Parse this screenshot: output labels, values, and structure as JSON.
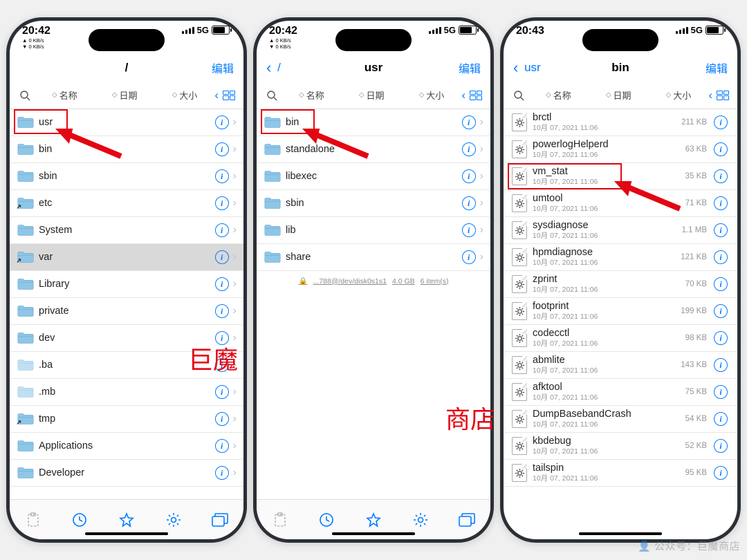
{
  "status": {
    "time1": "20:42",
    "time2": "20:42",
    "time3": "20:43",
    "kb_up": "▲ 0 KB/s",
    "kb_dn": "▼ 0 KB/s",
    "net": "5G"
  },
  "labels": {
    "edit": "编辑",
    "back_root": "/",
    "back_usr": "usr",
    "sort_name": "名称",
    "sort_date": "日期",
    "sort_size": "大小"
  },
  "phone1": {
    "title": "/",
    "items": [
      {
        "name": "usr"
      },
      {
        "name": "bin"
      },
      {
        "name": "sbin"
      },
      {
        "name": "etc"
      },
      {
        "name": "System"
      },
      {
        "name": "var",
        "sel": true
      },
      {
        "name": "Library"
      },
      {
        "name": "private"
      },
      {
        "name": "dev"
      },
      {
        "name": ".ba",
        "faded": true
      },
      {
        "name": ".mb",
        "faded": true
      },
      {
        "name": "tmp"
      },
      {
        "name": "Applications"
      },
      {
        "name": "Developer"
      }
    ]
  },
  "phone2": {
    "title": "usr",
    "items": [
      {
        "name": "bin"
      },
      {
        "name": "standalone"
      },
      {
        "name": "libexec"
      },
      {
        "name": "sbin"
      },
      {
        "name": "lib"
      },
      {
        "name": "share"
      }
    ],
    "disk_path": "...788@/dev/disk0s1s1",
    "disk_size": "4.0 GB",
    "disk_items": "6 item(s)"
  },
  "phone3": {
    "title": "bin",
    "date": "10月 07, 2021 11:06",
    "items": [
      {
        "name": "brctl",
        "size": "211 KB"
      },
      {
        "name": "powerlogHelperd",
        "size": "63 KB"
      },
      {
        "name": "vm_stat",
        "size": "35 KB"
      },
      {
        "name": "umtool",
        "size": "71 KB"
      },
      {
        "name": "sysdiagnose",
        "size": "1.1 MB"
      },
      {
        "name": "hpmdiagnose",
        "size": "121 KB"
      },
      {
        "name": "zprint",
        "size": "70 KB"
      },
      {
        "name": "footprint",
        "size": "199 KB"
      },
      {
        "name": "codecctl",
        "size": "98 KB"
      },
      {
        "name": "abmlite",
        "size": "143 KB"
      },
      {
        "name": "afktool",
        "size": "75 KB"
      },
      {
        "name": "DumpBasebandCrash",
        "size": "54 KB"
      },
      {
        "name": "kbdebug",
        "size": "52 KB"
      },
      {
        "name": "tailspin",
        "size": "95 KB"
      }
    ]
  },
  "annot": {
    "text1": "巨魔",
    "text2": "商店",
    "watermark": "👤 公众号：巨魔商店"
  }
}
